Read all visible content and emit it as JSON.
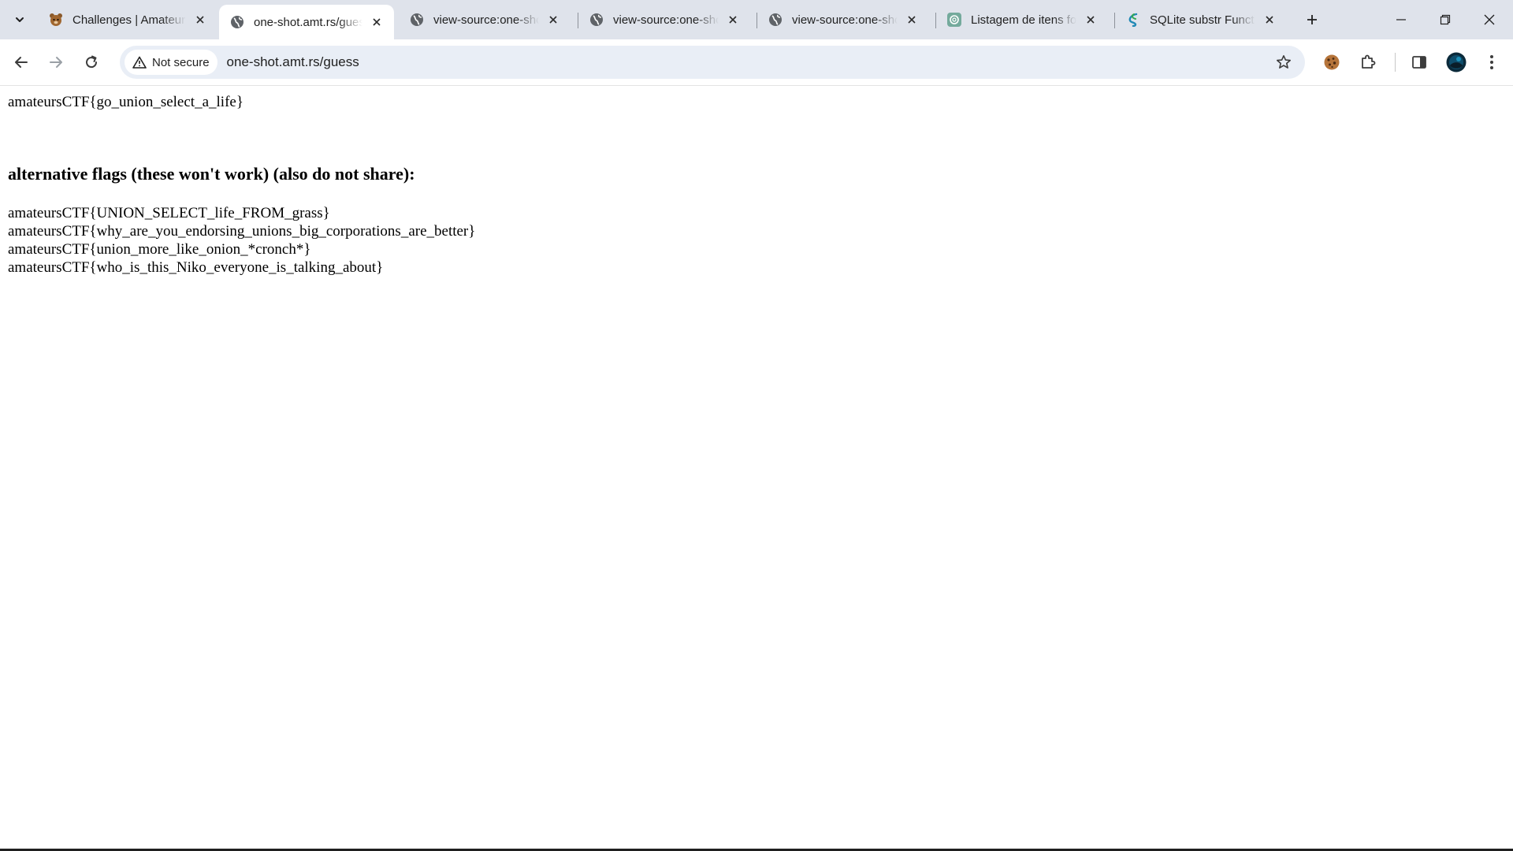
{
  "browser": {
    "tabs": [
      {
        "title": "Challenges | AmateursCTF",
        "favicon": "bear-icon",
        "active": false
      },
      {
        "title": "one-shot.amt.rs/guess",
        "favicon": "globe-icon",
        "active": true
      },
      {
        "title": "view-source:one-shot.amt.rs",
        "favicon": "globe-icon",
        "active": false
      },
      {
        "title": "view-source:one-shot.amt.rs",
        "favicon": "globe-icon",
        "active": false
      },
      {
        "title": "view-source:one-shot.amt.rs",
        "favicon": "globe-icon",
        "active": false
      },
      {
        "title": "Listagem de itens formatada",
        "favicon": "chatgpt-icon",
        "active": false
      },
      {
        "title": "SQLite substr Function",
        "favicon": "sqlite-icon",
        "active": false
      }
    ],
    "security_chip": "Not secure",
    "url": "one-shot.amt.rs/guess"
  },
  "page": {
    "flag": "amateursCTF{go_union_select_a_life}",
    "alt_heading": "alternative flags (these won't work) (also do not share):",
    "alt_flags": [
      "amateursCTF{UNION_SELECT_life_FROM_grass}",
      "amateursCTF{why_are_you_endorsing_unions_big_corporations_are_better}",
      "amateursCTF{union_more_like_onion_*cronch*}",
      "amateursCTF{who_is_this_Niko_everyone_is_talking_about}"
    ]
  },
  "colors": {
    "tabstrip": "#dfe3eb",
    "omnibox": "#e9eef6"
  }
}
